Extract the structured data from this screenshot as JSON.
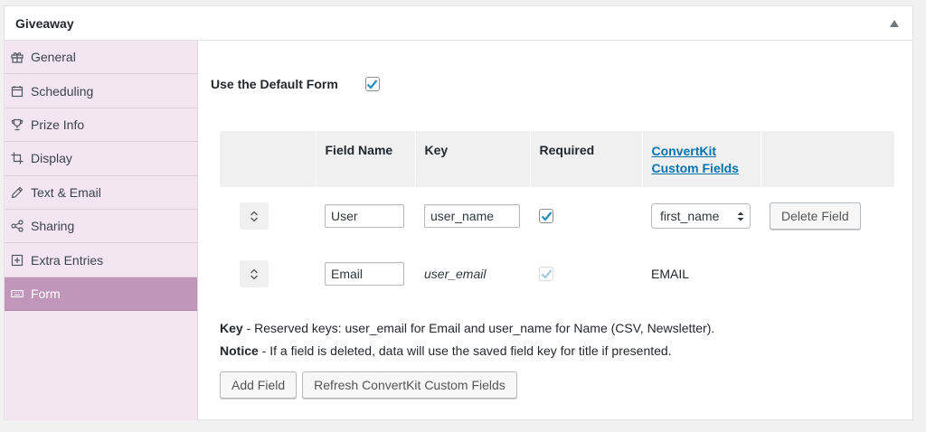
{
  "panel": {
    "title": "Giveaway"
  },
  "sidebar": {
    "items": [
      {
        "label": "General",
        "icon": "gift-icon"
      },
      {
        "label": "Scheduling",
        "icon": "calendar-icon"
      },
      {
        "label": "Prize Info",
        "icon": "trophy-icon"
      },
      {
        "label": "Display",
        "icon": "crop-icon"
      },
      {
        "label": "Text & Email",
        "icon": "pencil-icon"
      },
      {
        "label": "Sharing",
        "icon": "share-icon"
      },
      {
        "label": "Extra Entries",
        "icon": "plus-square-icon"
      },
      {
        "label": "Form",
        "icon": "keyboard-icon",
        "active": true
      }
    ]
  },
  "form": {
    "default_label": "Use the Default Form",
    "default_checked": true,
    "columns": {
      "field_name": "Field Name",
      "key": "Key",
      "required": "Required",
      "convertkit_line1": "ConvertKit",
      "convertkit_line2": "Custom Fields"
    },
    "rows": [
      {
        "field_name": "User",
        "key": "user_name",
        "required": true,
        "custom_field": "first_name",
        "delete_label": "Delete Field"
      },
      {
        "field_name": "Email",
        "key": "user_email",
        "required": true,
        "custom_field": "EMAIL"
      }
    ],
    "notes": {
      "key_term": "Key",
      "key_text": " - Reserved keys: user_email for Email and user_name for Name (CSV, Newsletter).",
      "notice_term": "Notice",
      "notice_text": " - If a field is deleted, data will use the saved field key for title if presented."
    },
    "add_field_label": "Add Field",
    "refresh_label": "Refresh ConvertKit Custom Fields"
  },
  "colors": {
    "accent": "#c196bb",
    "sidebar_bg": "#f3e6f0",
    "link": "#0073aa",
    "check": "#1e8cbe"
  }
}
